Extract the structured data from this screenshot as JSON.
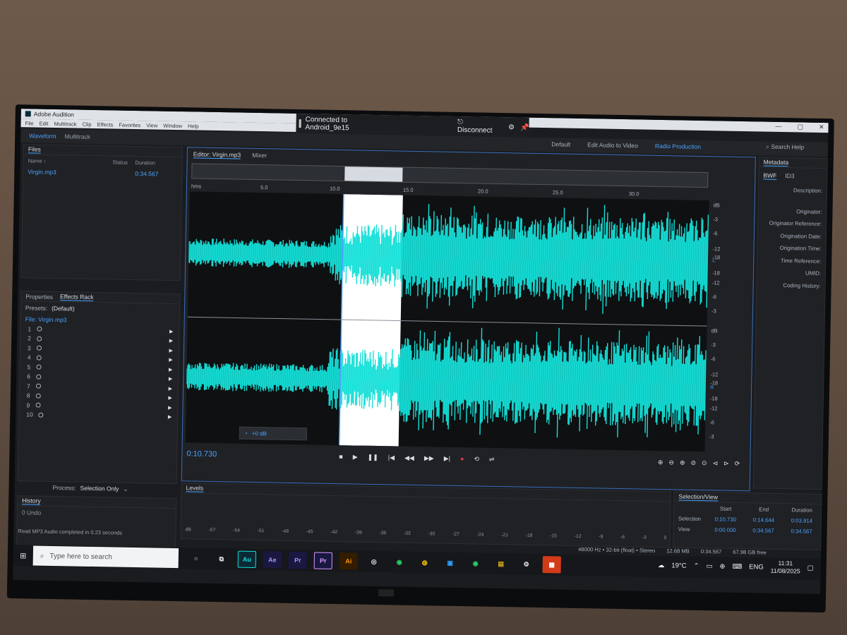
{
  "window": {
    "title": "Adobe Audition",
    "controls": [
      "—",
      "▢",
      "✕"
    ]
  },
  "menu": [
    "File",
    "Edit",
    "Multitrack",
    "Clip",
    "Effects",
    "Favorites",
    "View",
    "Window",
    "Help"
  ],
  "connection": {
    "label": "Connected to Android_9e15",
    "disconnect": "Disconnect"
  },
  "toolbar": {
    "waveform": "Waveform",
    "multitrack": "Multitrack"
  },
  "workspaces": {
    "default": "Default",
    "edit_video": "Edit Audio to Video",
    "radio": "Radio Production"
  },
  "search_help": "Search Help",
  "files_panel": {
    "title": "Files",
    "columns": {
      "name": "Name ↑",
      "status": "Status",
      "duration": "Duration"
    },
    "file": {
      "name": "Virgin.mp3",
      "duration": "0:34.567"
    }
  },
  "effects_panel": {
    "tab_properties": "Properties",
    "tab_effects": "Effects Rack",
    "presets_label": "Presets:",
    "presets_value": "(Default)",
    "file_line": "File: Virgin.mp3",
    "slots": [
      "1",
      "2",
      "3",
      "4",
      "5",
      "6",
      "7",
      "8",
      "9",
      "10"
    ]
  },
  "process": {
    "label": "Process:",
    "value": "Selection Only"
  },
  "history": {
    "title": "History",
    "undo": "0 Undo",
    "status": "Read MP3 Audio completed in 0.23 seconds"
  },
  "editor": {
    "tab": "Editor: Virgin.mp3",
    "mixer": "Mixer",
    "ruler": [
      "hms",
      "5.0",
      "10.0",
      "15.0",
      "20.0",
      "25.0",
      "30.0"
    ],
    "db_top": [
      "dB",
      "-3",
      "-6",
      "-12",
      "-18",
      "-18",
      "-12",
      "-6",
      "-3"
    ],
    "db_bottom": [
      "dB",
      "-3",
      "-6",
      "-12",
      "-18",
      "-18",
      "-12",
      "-6",
      "-3"
    ],
    "channel_l": "L",
    "channel_r": "R",
    "gain": "+0 dB",
    "timecode": "0:10.730"
  },
  "metadata": {
    "title": "Metadata",
    "tab_bwf": "BWF",
    "tab_id3": "ID3",
    "fields": [
      "Description:",
      "Originator:",
      "Originator Reference:",
      "Origination Date:",
      "Origination Time:",
      "Time Reference:",
      "UMID:",
      "Coding History:"
    ]
  },
  "levels": {
    "title": "Levels",
    "scale": [
      "dB",
      "-57",
      "-54",
      "-51",
      "-48",
      "-45",
      "-42",
      "-39",
      "-36",
      "-33",
      "-30",
      "-27",
      "-24",
      "-21",
      "-18",
      "-15",
      "-12",
      "-9",
      "-6",
      "-3",
      "0"
    ]
  },
  "selection_view": {
    "title": "Selection/View",
    "start": "Start",
    "end": "End",
    "duration": "Duration",
    "selection_label": "Selection",
    "view_label": "View",
    "selection": {
      "start": "0:10.730",
      "end": "0:14.644",
      "duration": "0:03.914"
    },
    "view": {
      "start": "0:00.000",
      "end": "0:34.567",
      "duration": "0:34.567"
    }
  },
  "info_bar": {
    "format": "48000 Hz • 32-bit (float) • Stereo",
    "size": "12.68 MB",
    "duration": "0:34.567",
    "free": "67.98 GB free"
  },
  "taskbar": {
    "search_placeholder": "Type here to search",
    "apps": [
      "Au",
      "Ae",
      "Pr",
      "Pr",
      "Ai"
    ],
    "weather": "19°C",
    "lang": "ENG",
    "time": "11:31",
    "date": "11/08/2025"
  },
  "colors": {
    "waveform": "#14e0d8",
    "selection": "#ffffff",
    "accent": "#4aa3ff"
  }
}
